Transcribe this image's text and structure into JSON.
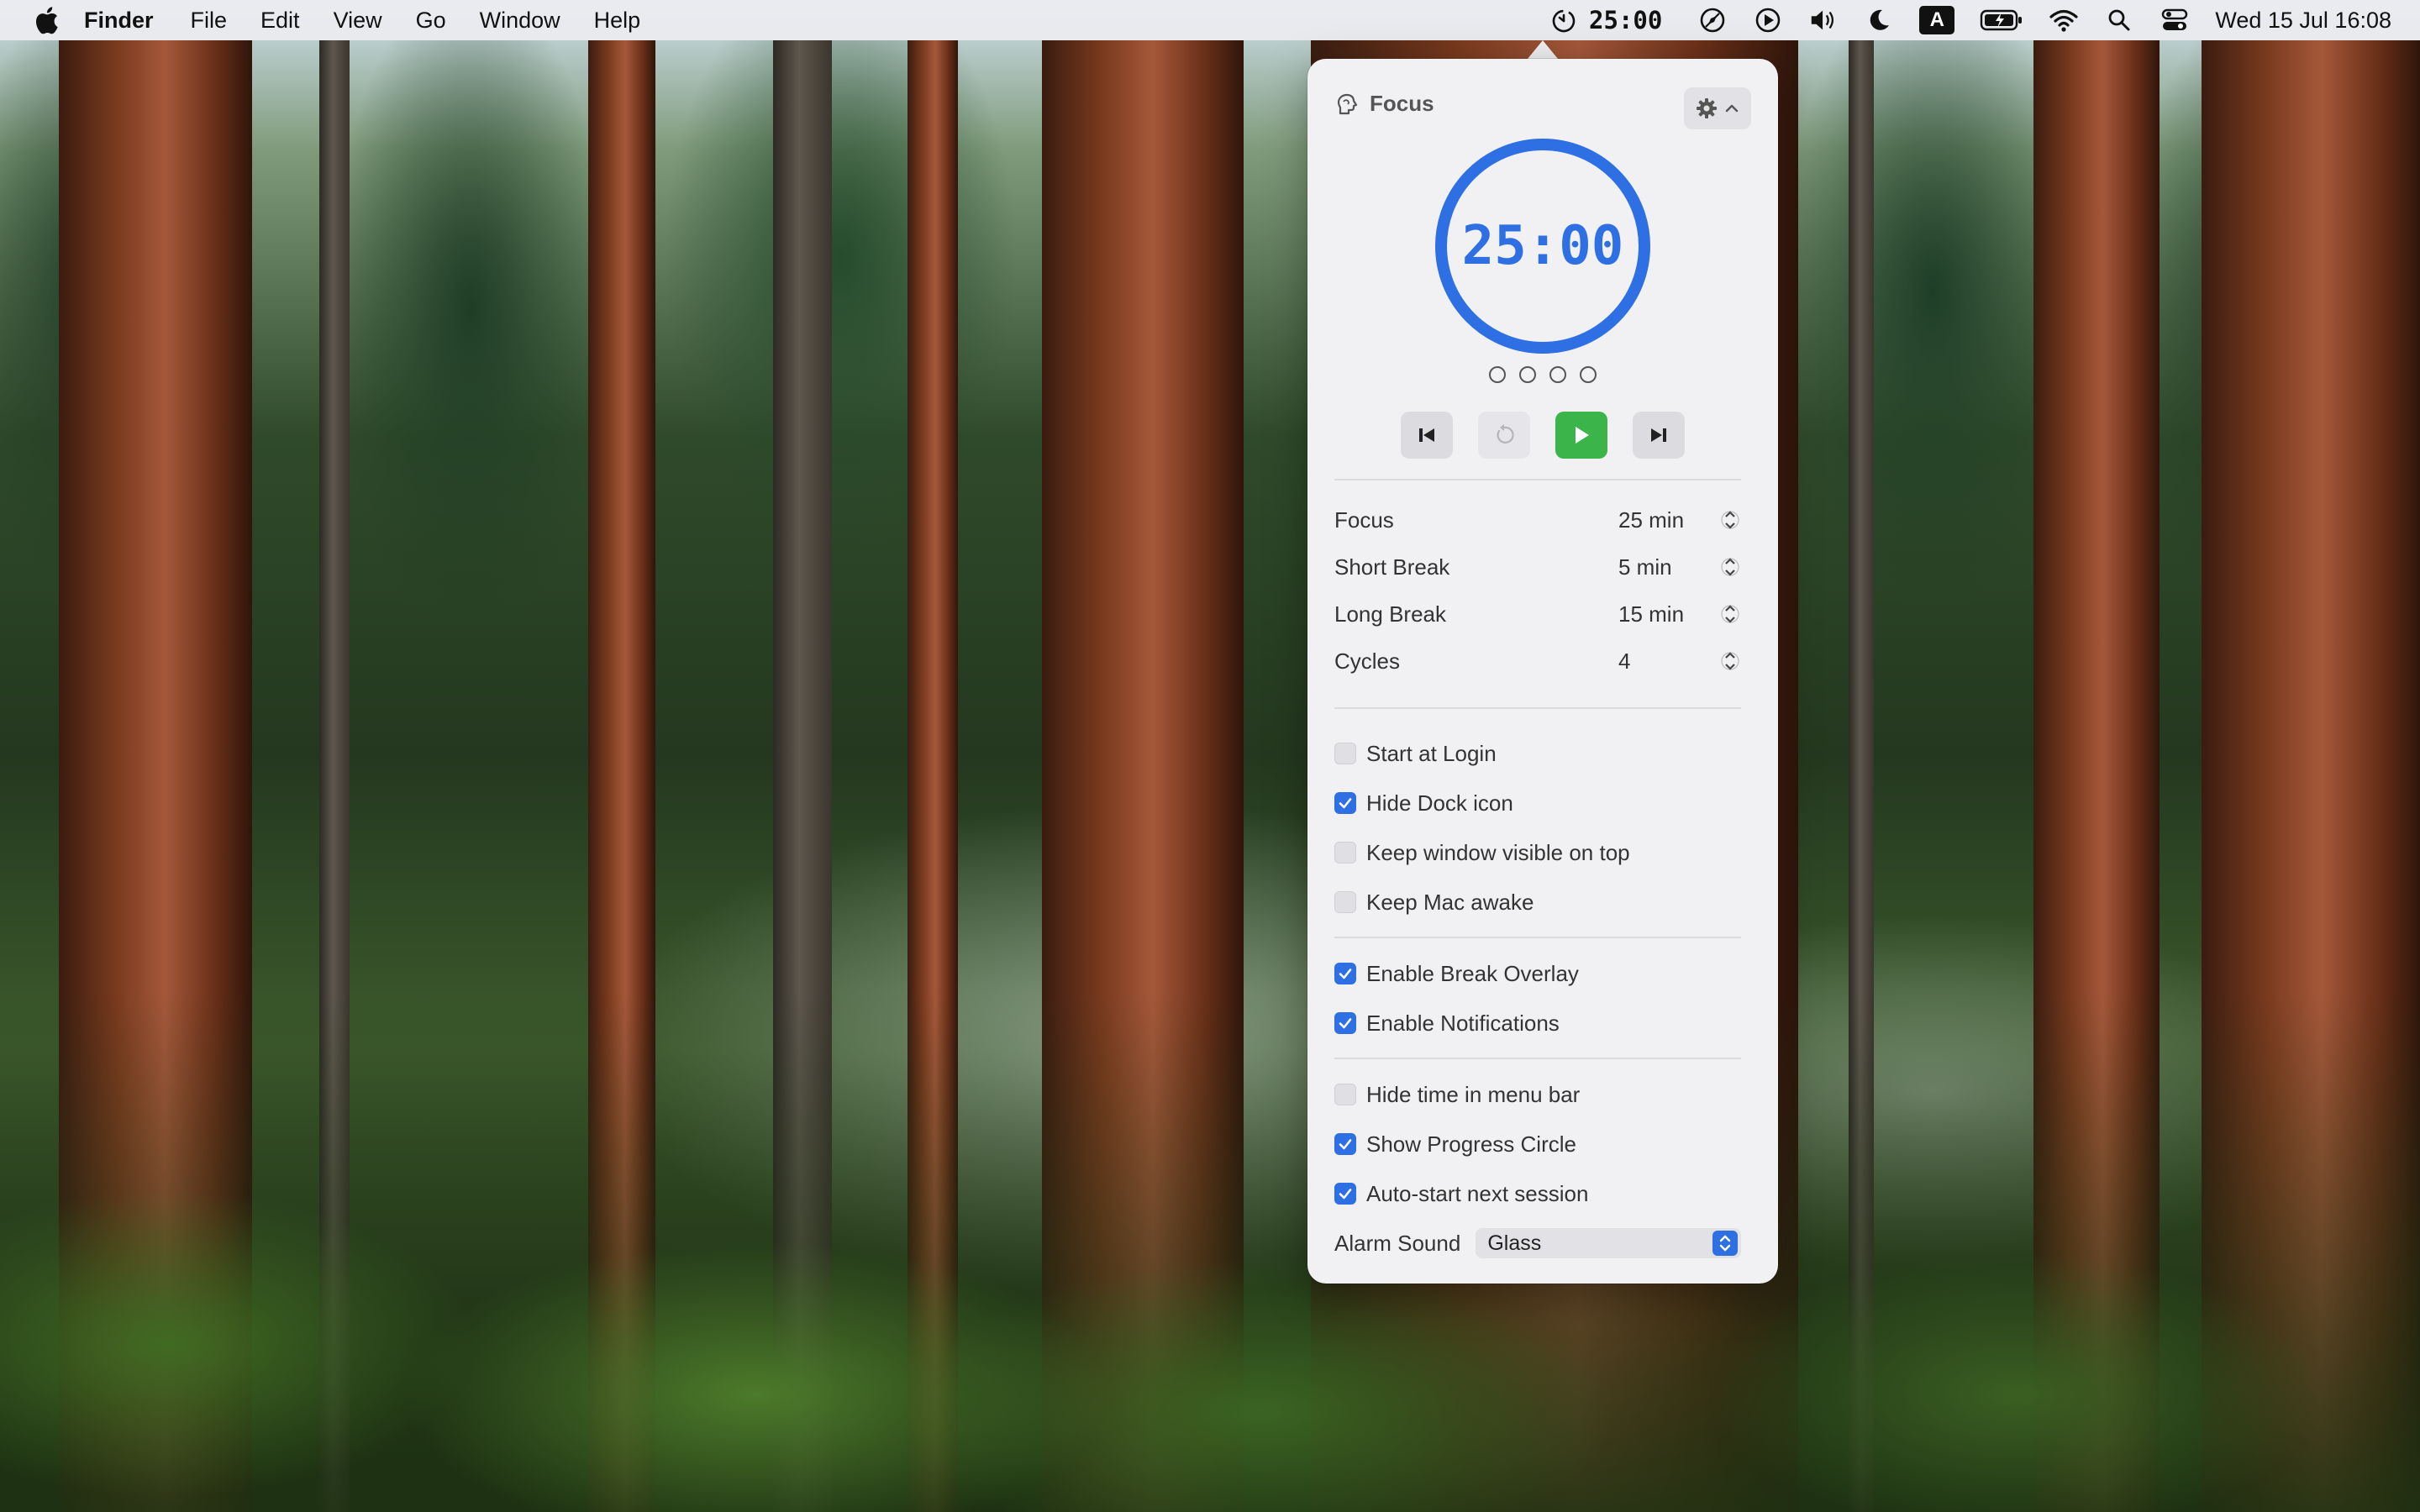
{
  "menubar": {
    "apple_icon": "apple-logo-icon",
    "app_name": "Finder",
    "menus": [
      "File",
      "Edit",
      "View",
      "Go",
      "Window",
      "Help"
    ],
    "status": {
      "timer_time": "25:00",
      "input_source": "A",
      "datetime": "Wed 15 Jul  16:08"
    }
  },
  "popover": {
    "title": "Focus",
    "timer": {
      "display": "25:00",
      "progress": 1.0,
      "cycles_total": 4,
      "cycles_completed": 0,
      "accent_color": "#2f6fe4"
    },
    "durations": [
      {
        "label": "Focus",
        "value": "25 min"
      },
      {
        "label": "Short Break",
        "value": "5 min"
      },
      {
        "label": "Long Break",
        "value": "15 min"
      },
      {
        "label": "Cycles",
        "value": "4"
      }
    ],
    "options_general": [
      {
        "label": "Start at Login",
        "checked": false
      },
      {
        "label": "Hide Dock icon",
        "checked": true
      },
      {
        "label": "Keep window visible on top",
        "checked": false
      },
      {
        "label": "Keep Mac awake",
        "checked": false
      }
    ],
    "options_breaks": [
      {
        "label": "Enable Break Overlay",
        "checked": true
      },
      {
        "label": "Enable Notifications",
        "checked": true
      }
    ],
    "options_display": [
      {
        "label": "Hide time in menu bar",
        "checked": false
      },
      {
        "label": "Show Progress Circle",
        "checked": true
      },
      {
        "label": "Auto-start next session",
        "checked": true
      }
    ],
    "alarm": {
      "label": "Alarm Sound",
      "value": "Glass"
    },
    "colors": {
      "play_button": "#3bb54a",
      "checkbox_on": "#2f6fe4"
    }
  }
}
